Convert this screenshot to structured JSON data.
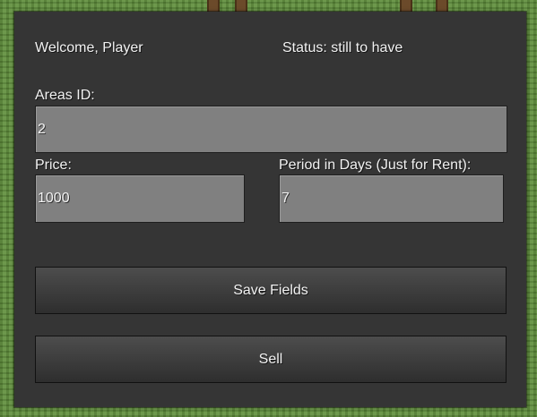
{
  "header": {
    "welcome": "Welcome, Player",
    "status": "Status: still to have"
  },
  "form": {
    "areas_id": {
      "label": "Areas ID:",
      "value": "2"
    },
    "price": {
      "label": "Price:",
      "value": "1000"
    },
    "period": {
      "label": "Period in Days (Just for Rent):",
      "value": "7"
    }
  },
  "actions": {
    "save_label": "Save Fields",
    "sell_label": "Sell"
  },
  "colors": {
    "panel": "#353535",
    "field": "#808080",
    "text": "#f2f2f2"
  }
}
